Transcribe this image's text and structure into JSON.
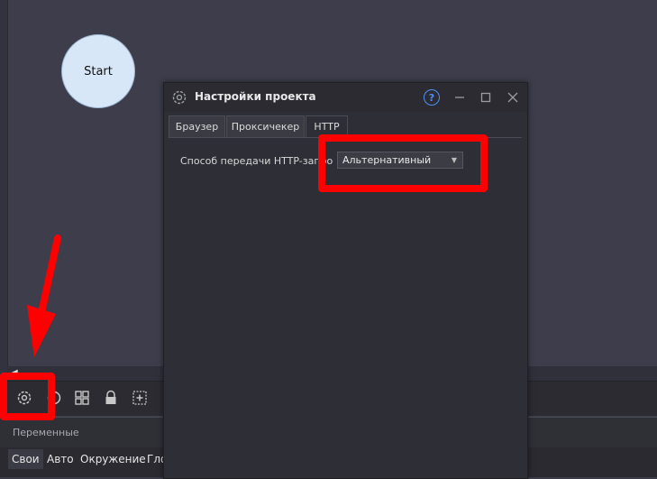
{
  "canvas": {
    "start_node_label": "Start"
  },
  "dialog": {
    "title": "Настройки проекта",
    "help_label": "?",
    "tabs": [
      {
        "label": "Браузер"
      },
      {
        "label": "Проксичекер"
      },
      {
        "label": "HTTP"
      }
    ],
    "active_tab": "HTTP",
    "setting_label": "Способ передачи HTTP-запросов",
    "setting_value": "Альтернативный"
  },
  "variables_panel": {
    "title": "Переменные",
    "tabs": [
      {
        "label": "Свои"
      },
      {
        "label": "Авто"
      },
      {
        "label": "Окружение"
      },
      {
        "label": "Гло"
      }
    ]
  },
  "colors": {
    "highlight": "#ff0000",
    "help_accent": "#4f8ff7"
  }
}
